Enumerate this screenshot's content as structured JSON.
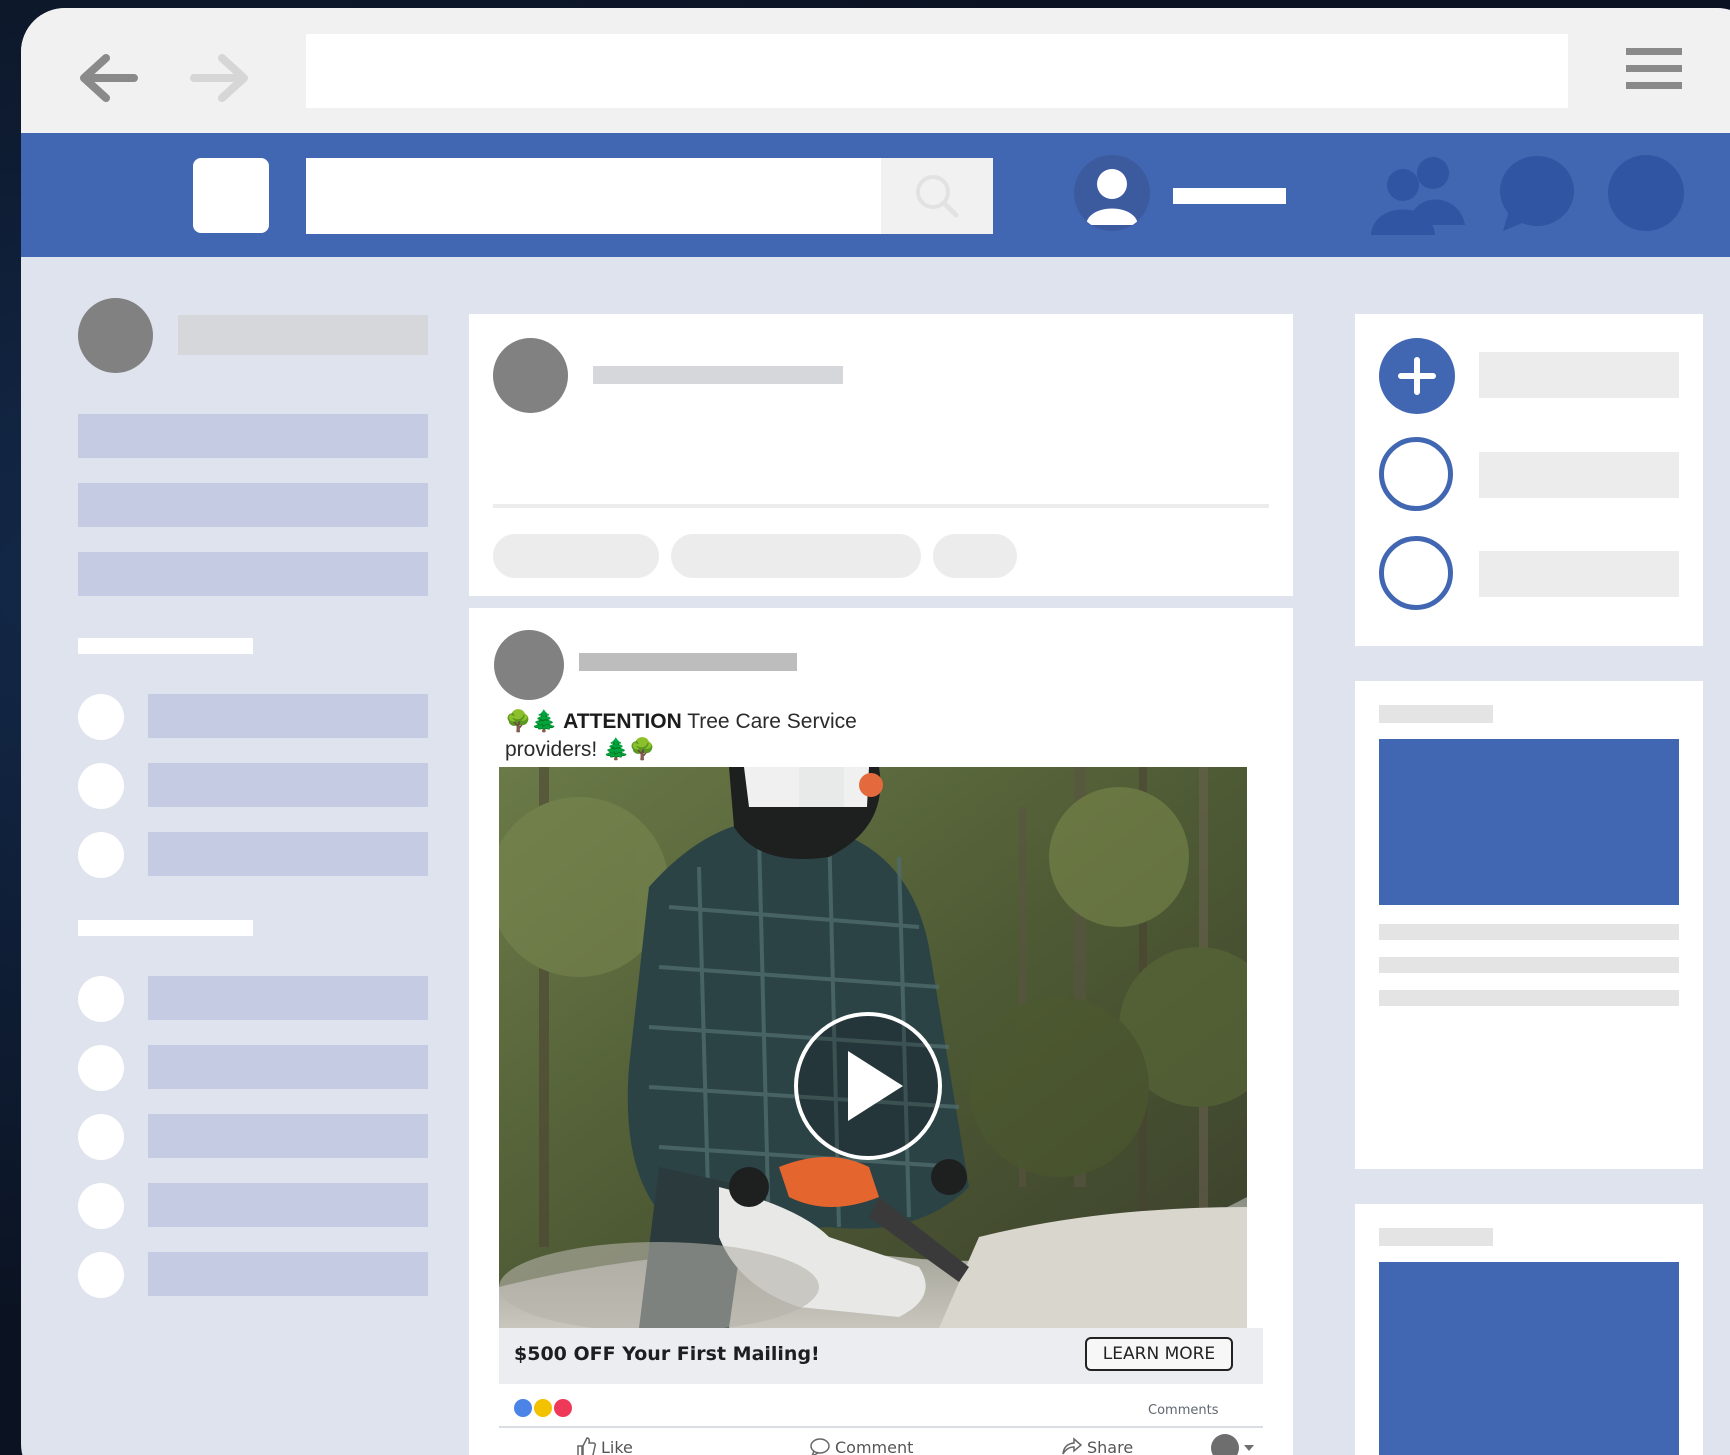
{
  "browser": {
    "back_icon": "arrow-left-icon",
    "forward_icon": "arrow-right-icon",
    "address_value": "",
    "menu_icon": "hamburger-menu-icon"
  },
  "header": {
    "logo_icon": "logo-square-icon",
    "search_placeholder": "",
    "search_icon": "search-icon",
    "profile_icon": "user-avatar-icon",
    "friends_icon": "friends-icon",
    "messages_icon": "chat-bubble-icon",
    "notifications_icon": "notification-circle-icon",
    "brand_color": "#4267b2"
  },
  "post": {
    "text_emoji_left": "🌳🌲",
    "text_bold": "ATTENTION",
    "text_rest": " Tree Care Service",
    "text_line2": "providers!",
    "text_emoji_right": "🌲🌳",
    "video_play_icon": "play-icon",
    "cta_title": "$500 OFF Your First Mailing!",
    "cta_button": "LEARN MORE",
    "reactions": [
      "like-reaction-icon",
      "wow-reaction-icon",
      "love-reaction-icon"
    ],
    "comments_label": "Comments",
    "actions": {
      "like": "Like",
      "comment": "Comment",
      "share": "Share"
    }
  },
  "sidebar_right": {
    "add_icon": "plus-icon"
  },
  "colors": {
    "page_bg": "#dfe3ee",
    "skeleton_blue": "#c5cbe2",
    "skeleton_gray": "#d5d7db"
  }
}
